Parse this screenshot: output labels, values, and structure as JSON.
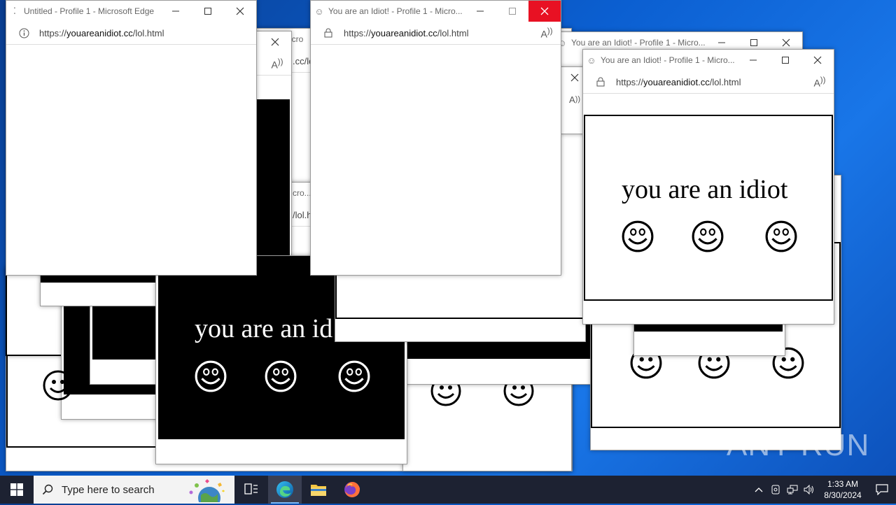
{
  "windows": {
    "untitled": {
      "title": "Untitled - Profile 1 - Microsoft Edge",
      "url_prefix": "https://",
      "url_domain": "youareanidiot.cc",
      "url_path": "/lol.html"
    },
    "front_center": {
      "title": "You are an Idiot! - Profile 1 - Micro...",
      "url_prefix": "https://",
      "url_domain": "youareanidiot.cc",
      "url_path": "/lol.html"
    },
    "right_back": {
      "title": "You are an Idiot! - Profile 1 - Micro..."
    },
    "right_front": {
      "title": "You are an Idiot! - Profile 1 - Micro...",
      "url_prefix": "https://",
      "url_domain": "youareanidiot.cc",
      "url_path": "/lol.html",
      "message": "you are an idiot"
    },
    "bottom_center": {
      "message": "you are an id"
    },
    "fragments": {
      "url_frag_1": ".cc/lo",
      "url_frag_2": "/lol.h",
      "title_frag_1": "icro",
      "title_frag_2": "cro..."
    }
  },
  "taskbar": {
    "search_placeholder": "Type here to search",
    "time": "1:33 AM",
    "date": "8/30/2024"
  },
  "watermark": "ANY RUN",
  "colors": {
    "close_red": "#e81123",
    "taskbar": "#1d2232",
    "desktop_blue": "#0b5fd1"
  }
}
